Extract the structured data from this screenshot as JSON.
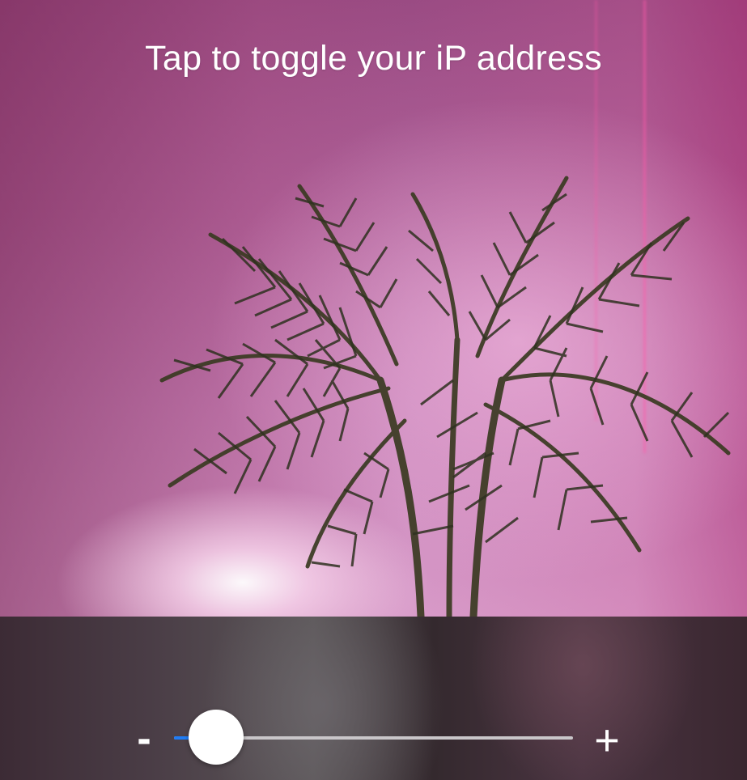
{
  "overlay": {
    "hint": "Tap to toggle your iP address"
  },
  "zoom": {
    "minus_label": "-",
    "plus_label": "+",
    "level": 0.04,
    "fill_color": "#1f7cf5",
    "track_color": "#c9c6c9",
    "thumb_color": "#ffffff"
  },
  "icons": {
    "minus": "minus-icon",
    "plus": "plus-icon"
  }
}
